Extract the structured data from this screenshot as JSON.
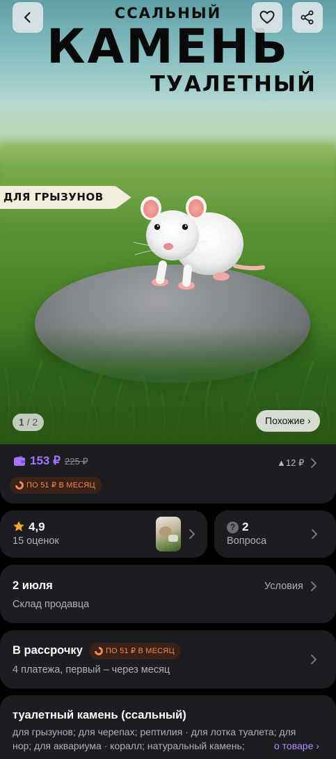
{
  "hero": {
    "title_top": "ССАЛЬНЫЙ",
    "title_main": "КАМЕНЬ",
    "title_bottom": "ТУАЛЕТНЫЙ",
    "ribbon": "ДЛЯ ГРЫЗУНОВ",
    "pager_current": "1",
    "pager_total": "/ 2",
    "similar_label": "Похожие ›",
    "icons": {
      "back": "chevron-left-icon",
      "favorite": "heart-icon",
      "share": "share-icon"
    }
  },
  "price": {
    "current": "153 ₽",
    "old": "225 ₽",
    "change": "▲12 ₽",
    "installment_badge": "ПО 51 ₽ В МЕСЯЦ",
    "accent_color": "#a575ff",
    "badge_color": "#f28a4a"
  },
  "rating": {
    "value": "4,9",
    "count_label": "15 оценок",
    "star_color": "#f5a623"
  },
  "questions": {
    "count": "2",
    "label": "Вопроса"
  },
  "delivery": {
    "date": "2 июля",
    "source": "Склад продавца",
    "terms_label": "Условия"
  },
  "installment": {
    "title": "В рассрочку",
    "badge": "ПО 51 ₽ В МЕСЯЦ",
    "details": "4 платежа, первый – через месяц"
  },
  "description": {
    "title": "туалетный камень (ссальный)",
    "line1": "для грызунов; для черепах; рептилия · для лотка туалета; для",
    "line2": "нор; для аквариума · коралл; натуральный камень;",
    "more_link": "о товаре ›"
  }
}
